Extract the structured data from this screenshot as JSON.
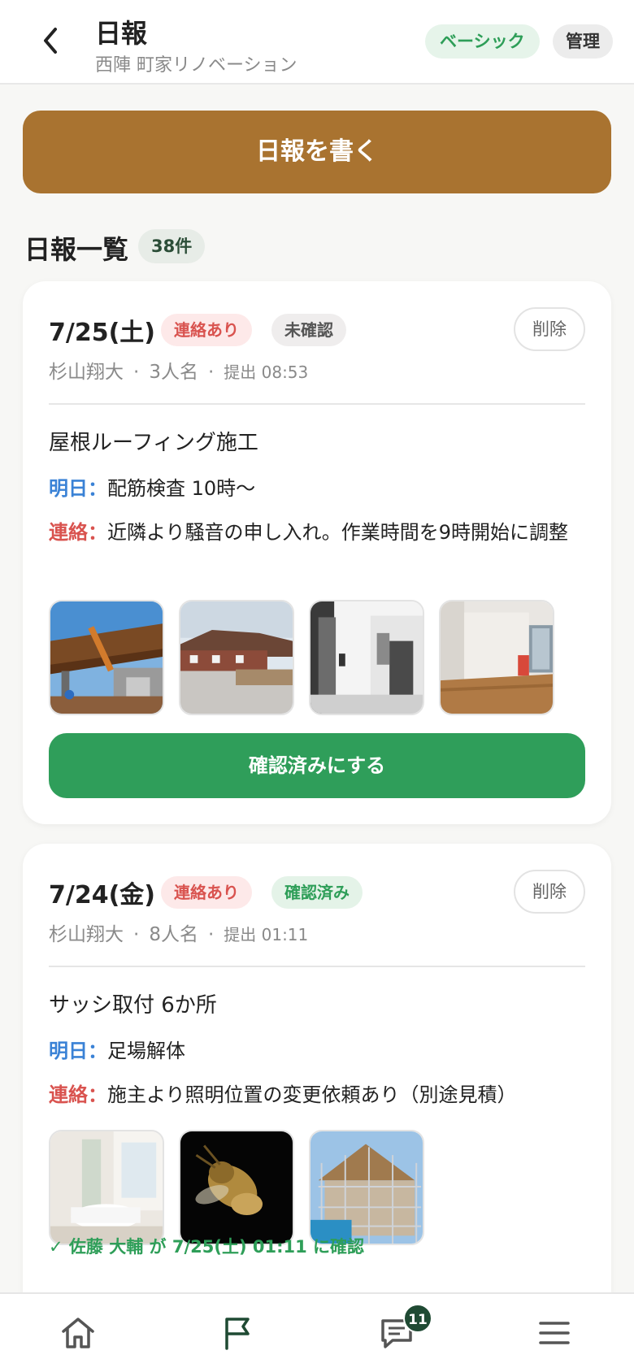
{
  "header": {
    "title": "日報",
    "subtitle": "西陣 町家リノベーション",
    "plan_badge": "ベーシック",
    "admin_badge": "管理"
  },
  "write_button": "日報を書く",
  "list": {
    "title": "日報一覧",
    "count": "38件"
  },
  "reports": [
    {
      "date": "7/25(土)",
      "contact_tag": "連絡あり",
      "status_tag": "未確認",
      "delete_label": "削除",
      "author": "杉山翔大",
      "workers": "3人名",
      "submitted": "提出 08:53",
      "work": "屋根ルーフィング施工",
      "tomorrow_label": "明日：",
      "tomorrow": "配筋検査 10時〜",
      "contact_label": "連絡：",
      "contact": "近隣より騒音の申し入れ。作業時間を9時開始に調整",
      "photo_count": 4,
      "confirm_button": "確認済みにする"
    },
    {
      "date": "7/24(金)",
      "contact_tag": "連絡あり",
      "status_tag": "確認済み",
      "delete_label": "削除",
      "author": "杉山翔大",
      "workers": "8人名",
      "submitted": "提出 01:11",
      "work": "サッシ取付 6か所",
      "tomorrow_label": "明日：",
      "tomorrow": "足場解体",
      "contact_label": "連絡：",
      "contact": "施主より照明位置の変更依頼あり（別途見積）",
      "photo_count": 3,
      "confirmed_note": "✓ 佐藤 大輔 が 7/25(土) 01:11 に確認"
    }
  ],
  "nav": {
    "items": [
      "home-icon",
      "flag-icon",
      "chat-icon",
      "menu-icon"
    ],
    "chat_badge": "11"
  },
  "colors": {
    "primary_brown": "#a97330",
    "green": "#2f9e5a",
    "red": "#d9534f",
    "blue": "#3a82d6",
    "nav_dark": "#1f4a33"
  }
}
